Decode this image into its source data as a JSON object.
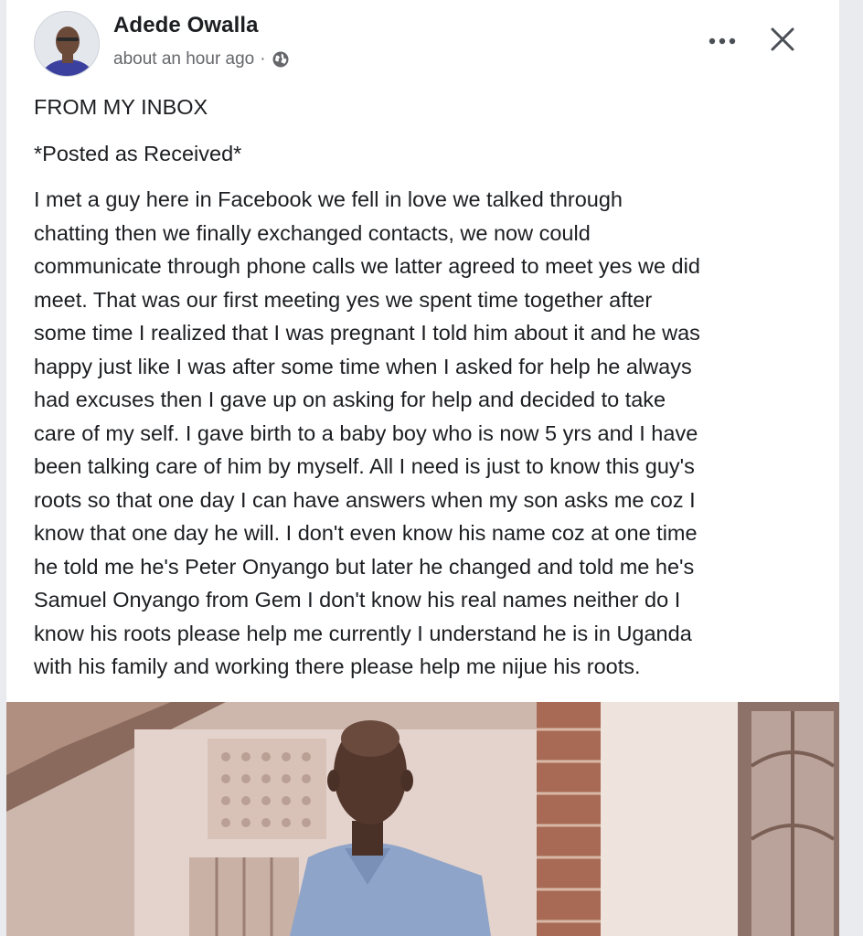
{
  "post": {
    "author": "Adede Owalla",
    "timestamp": "about an hour ago",
    "separator": "·",
    "audience_icon": "globe-icon",
    "more_icon": "more-options-icon",
    "close_icon": "close-icon",
    "heading": "FROM MY INBOX",
    "subheading": "*Posted as Received*",
    "body_lines": [
      "I met a guy here in Facebook we fell in love we talked through",
      "chatting then we finally exchanged contacts, we now could",
      "communicate through phone calls we latter agreed to meet yes we did",
      "meet. That was our first meeting yes we spent time together after",
      "some time I realized that I was pregnant I told him about it and he was",
      "happy just like I was after some time when I asked for help he always",
      "had excuses then I gave up on asking for help and decided to take",
      "care of my self. I gave birth to a baby boy who is now 5 yrs and I have",
      "been talking care of him by myself. All I need is just to know this guy's",
      "roots so that one day I can have answers when my son asks me coz I",
      "know that one day he will. I don't even know his name coz at one time",
      "he told me he's Peter Onyango but later he changed and told me he's",
      "Samuel Onyango from Gem I don't know his real names neither do I",
      "know his roots please help me currently I understand he is in Uganda",
      "with his family and working there please help me nijue his roots."
    ]
  },
  "colors": {
    "text_primary": "#1c1e21",
    "text_secondary": "#65676b",
    "background": "#ffffff"
  }
}
